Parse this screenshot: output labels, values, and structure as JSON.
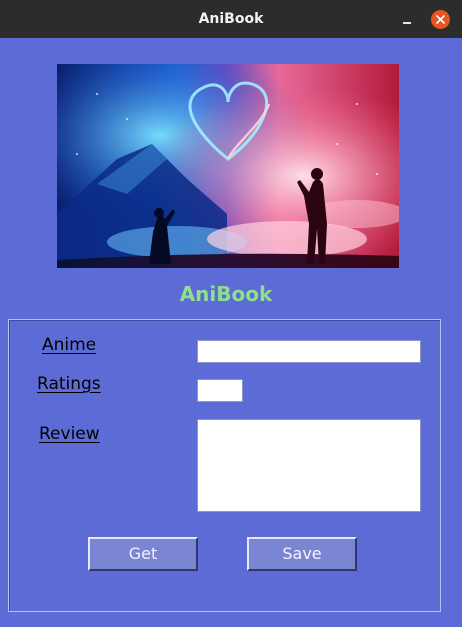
{
  "window": {
    "title": "AniBook"
  },
  "header": {
    "app_name": "AniBook"
  },
  "form": {
    "anime_label": "Anime",
    "ratings_label": "Ratings",
    "review_label": "Review",
    "anime_value": "",
    "ratings_value": "",
    "review_value": ""
  },
  "buttons": {
    "get_label": "Get",
    "save_label": "Save"
  },
  "colors": {
    "window_bg": "#5c6bd6",
    "titlebar_bg": "#2c2c2c",
    "close_button": "#e95420",
    "heading_text": "#8fe08a",
    "button_bg": "#7a86d4"
  },
  "icons": {
    "minimize": "minimize-icon",
    "close": "close-icon"
  }
}
